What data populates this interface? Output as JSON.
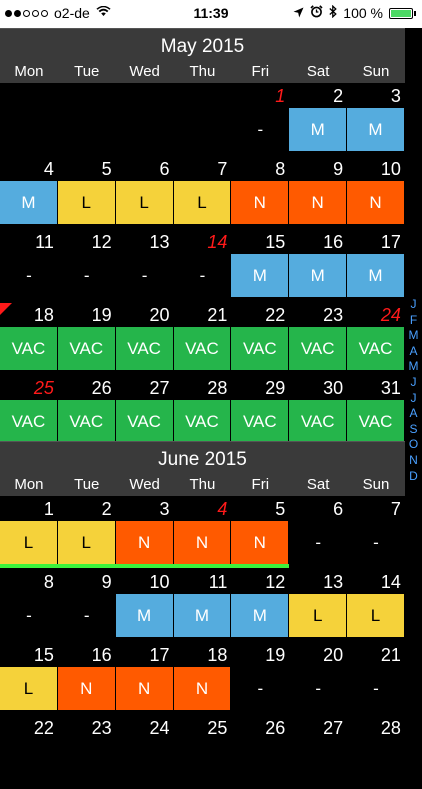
{
  "status_bar": {
    "signal_dots": [
      true,
      true,
      false,
      false,
      false
    ],
    "carrier": "o2-de",
    "time": "11:39",
    "battery": "100 %",
    "icons": [
      "location-arrow-icon",
      "alarm-icon",
      "bluetooth-icon",
      "wifi-icon",
      "battery-charging-icon"
    ]
  },
  "colors": {
    "M": "#55acde",
    "L": "#f5d23a",
    "N": "#ff5a00",
    "VAC": "#25b54b",
    "holiday": "#ff1a1a",
    "today_marker": "#3cf23c",
    "index": "#4aa0ff"
  },
  "weekdays": [
    "Mon",
    "Tue",
    "Wed",
    "Thu",
    "Fri",
    "Sat",
    "Sun"
  ],
  "months": [
    {
      "title": "May 2015",
      "weeks": [
        [
          {
            "day": "",
            "shift": ""
          },
          {
            "day": "",
            "shift": ""
          },
          {
            "day": "",
            "shift": ""
          },
          {
            "day": "",
            "shift": ""
          },
          {
            "day": "1",
            "shift": "-",
            "holiday": true
          },
          {
            "day": "2",
            "shift": "M"
          },
          {
            "day": "3",
            "shift": "M"
          }
        ],
        [
          {
            "day": "4",
            "shift": "M"
          },
          {
            "day": "5",
            "shift": "L"
          },
          {
            "day": "6",
            "shift": "L"
          },
          {
            "day": "7",
            "shift": "L"
          },
          {
            "day": "8",
            "shift": "N"
          },
          {
            "day": "9",
            "shift": "N"
          },
          {
            "day": "10",
            "shift": "N"
          }
        ],
        [
          {
            "day": "11",
            "shift": "-"
          },
          {
            "day": "12",
            "shift": "-"
          },
          {
            "day": "13",
            "shift": "-"
          },
          {
            "day": "14",
            "shift": "-",
            "holiday": true
          },
          {
            "day": "15",
            "shift": "M"
          },
          {
            "day": "16",
            "shift": "M"
          },
          {
            "day": "17",
            "shift": "M"
          }
        ],
        [
          {
            "day": "18",
            "shift": "VAC",
            "flag": true
          },
          {
            "day": "19",
            "shift": "VAC"
          },
          {
            "day": "20",
            "shift": "VAC"
          },
          {
            "day": "21",
            "shift": "VAC"
          },
          {
            "day": "22",
            "shift": "VAC"
          },
          {
            "day": "23",
            "shift": "VAC"
          },
          {
            "day": "24",
            "shift": "VAC",
            "holiday": true
          }
        ],
        [
          {
            "day": "25",
            "shift": "VAC",
            "holiday": true
          },
          {
            "day": "26",
            "shift": "VAC",
            "marker": true
          },
          {
            "day": "27",
            "shift": "VAC",
            "marker": true
          },
          {
            "day": "28",
            "shift": "VAC",
            "marker": true
          },
          {
            "day": "29",
            "shift": "VAC",
            "marker": true
          },
          {
            "day": "30",
            "shift": "VAC",
            "marker": true
          },
          {
            "day": "31",
            "shift": "VAC",
            "marker": true
          }
        ]
      ]
    },
    {
      "title": "June 2015",
      "weeks": [
        [
          {
            "day": "1",
            "shift": "L",
            "marker": true
          },
          {
            "day": "2",
            "shift": "L",
            "marker": true
          },
          {
            "day": "3",
            "shift": "N",
            "marker": true
          },
          {
            "day": "4",
            "shift": "N",
            "holiday": true,
            "marker": true
          },
          {
            "day": "5",
            "shift": "N",
            "marker": true
          },
          {
            "day": "6",
            "shift": "-"
          },
          {
            "day": "7",
            "shift": "-"
          }
        ],
        [
          {
            "day": "8",
            "shift": "-"
          },
          {
            "day": "9",
            "shift": "-"
          },
          {
            "day": "10",
            "shift": "M"
          },
          {
            "day": "11",
            "shift": "M"
          },
          {
            "day": "12",
            "shift": "M"
          },
          {
            "day": "13",
            "shift": "L"
          },
          {
            "day": "14",
            "shift": "L"
          }
        ],
        [
          {
            "day": "15",
            "shift": "L"
          },
          {
            "day": "16",
            "shift": "N"
          },
          {
            "day": "17",
            "shift": "N"
          },
          {
            "day": "18",
            "shift": "N"
          },
          {
            "day": "19",
            "shift": "-"
          },
          {
            "day": "20",
            "shift": "-"
          },
          {
            "day": "21",
            "shift": "-"
          }
        ],
        [
          {
            "day": "22",
            "shift": ""
          },
          {
            "day": "23",
            "shift": ""
          },
          {
            "day": "24",
            "shift": ""
          },
          {
            "day": "25",
            "shift": ""
          },
          {
            "day": "26",
            "shift": ""
          },
          {
            "day": "27",
            "shift": ""
          },
          {
            "day": "28",
            "shift": ""
          }
        ]
      ]
    }
  ],
  "month_index": [
    "J",
    "F",
    "M",
    "A",
    "M",
    "J",
    "J",
    "A",
    "S",
    "O",
    "N",
    "D"
  ]
}
